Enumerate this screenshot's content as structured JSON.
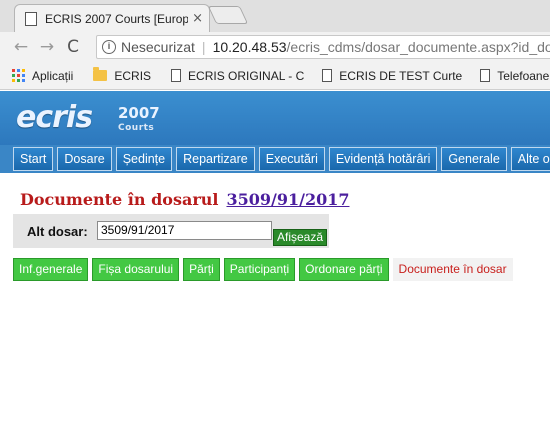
{
  "browser": {
    "tab_title": "ECRIS 2007 Courts [Europ",
    "tab_close": "×",
    "address": {
      "security_label": "Nesecurizat",
      "separator": "|",
      "host": "10.20.48.53",
      "path": "/ecris_cdms/dosar_documente.aspx?id_dosa"
    },
    "nav": {
      "back": "←",
      "forward": "→",
      "reload": "C"
    },
    "bookmarks": [
      {
        "label": "Aplicații",
        "icon": "apps-grid-icon"
      },
      {
        "label": "ECRIS",
        "icon": "folder-icon"
      },
      {
        "label": "ECRIS  ORIGINAL - C",
        "icon": "page-icon"
      },
      {
        "label": "ECRIS DE TEST Curte",
        "icon": "page-icon"
      },
      {
        "label": "Telefoane int",
        "icon": "page-icon"
      }
    ]
  },
  "header": {
    "logo": "ecris",
    "year": "2007",
    "subtitle": "Courts"
  },
  "menu": [
    "Start",
    "Dosare",
    "Ședințe",
    "Repartizare",
    "Executări",
    "Evidență hotărâri",
    "Generale",
    "Alte o"
  ],
  "page": {
    "heading": "Documente în dosarul",
    "case_number": "3509/91/2017",
    "alt_label": "Alt dosar:",
    "alt_value": "3509/91/2017",
    "show_button": "Afișează"
  },
  "subtabs": [
    "Inf.generale",
    "Fișa dosarului",
    "Părți",
    "Participanți",
    "Ordonare părți",
    "Documente în dosar"
  ],
  "colors": {
    "banner": "#2d78bd",
    "menu_button": "#1a68ac",
    "heading": "#b81b1b",
    "case_link": "#4b1f9e",
    "subtab_green": "#43c843",
    "active_tab_text": "#c8201d"
  }
}
